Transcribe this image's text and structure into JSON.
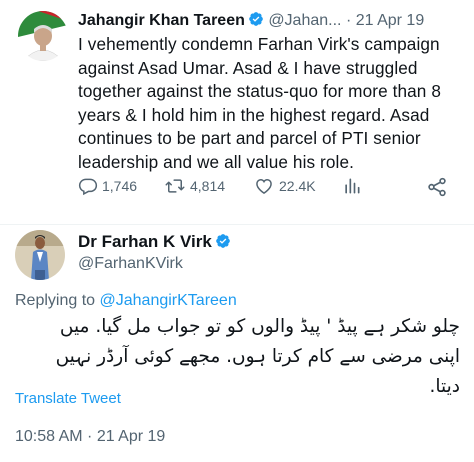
{
  "tweet1": {
    "author_name": "Jahangir Khan Tareen",
    "author_handle": "@Jahan...",
    "separator": "·",
    "date": "21 Apr 19",
    "text": "I vehemently condemn Farhan Virk's campaign against Asad Umar. Asad & I have struggled together against the status-quo for more than 8 years & I hold him in the highest regard. Asad continues to be part and parcel of PTI senior leadership and we all value his role.",
    "replies": "1,746",
    "retweets": "4,814",
    "likes": "22.4K"
  },
  "tweet2": {
    "author_name": "Dr Farhan K Virk",
    "author_handle": "@FarhanKVirk",
    "replying_prefix": "Replying to",
    "replying_to": "@JahangirKTareen",
    "text": "چلو شکر ہے پیڈ ' پیڈ والوں کو تو جواب مل گیا. میں اپنی مرضی سے کام کرتا ہوں. مجھے کوئی آرڈر نہیں دیتا.",
    "translate_label": "Translate Tweet",
    "timestamp": "10:58 AM · 21 Apr 19"
  },
  "colors": {
    "accent": "#1d9bf0",
    "secondary_text": "#536471",
    "primary_text": "#0f1419"
  },
  "icons": [
    "reply-icon",
    "retweet-icon",
    "like-icon",
    "analytics-icon",
    "share-icon",
    "verified-badge-icon"
  ]
}
